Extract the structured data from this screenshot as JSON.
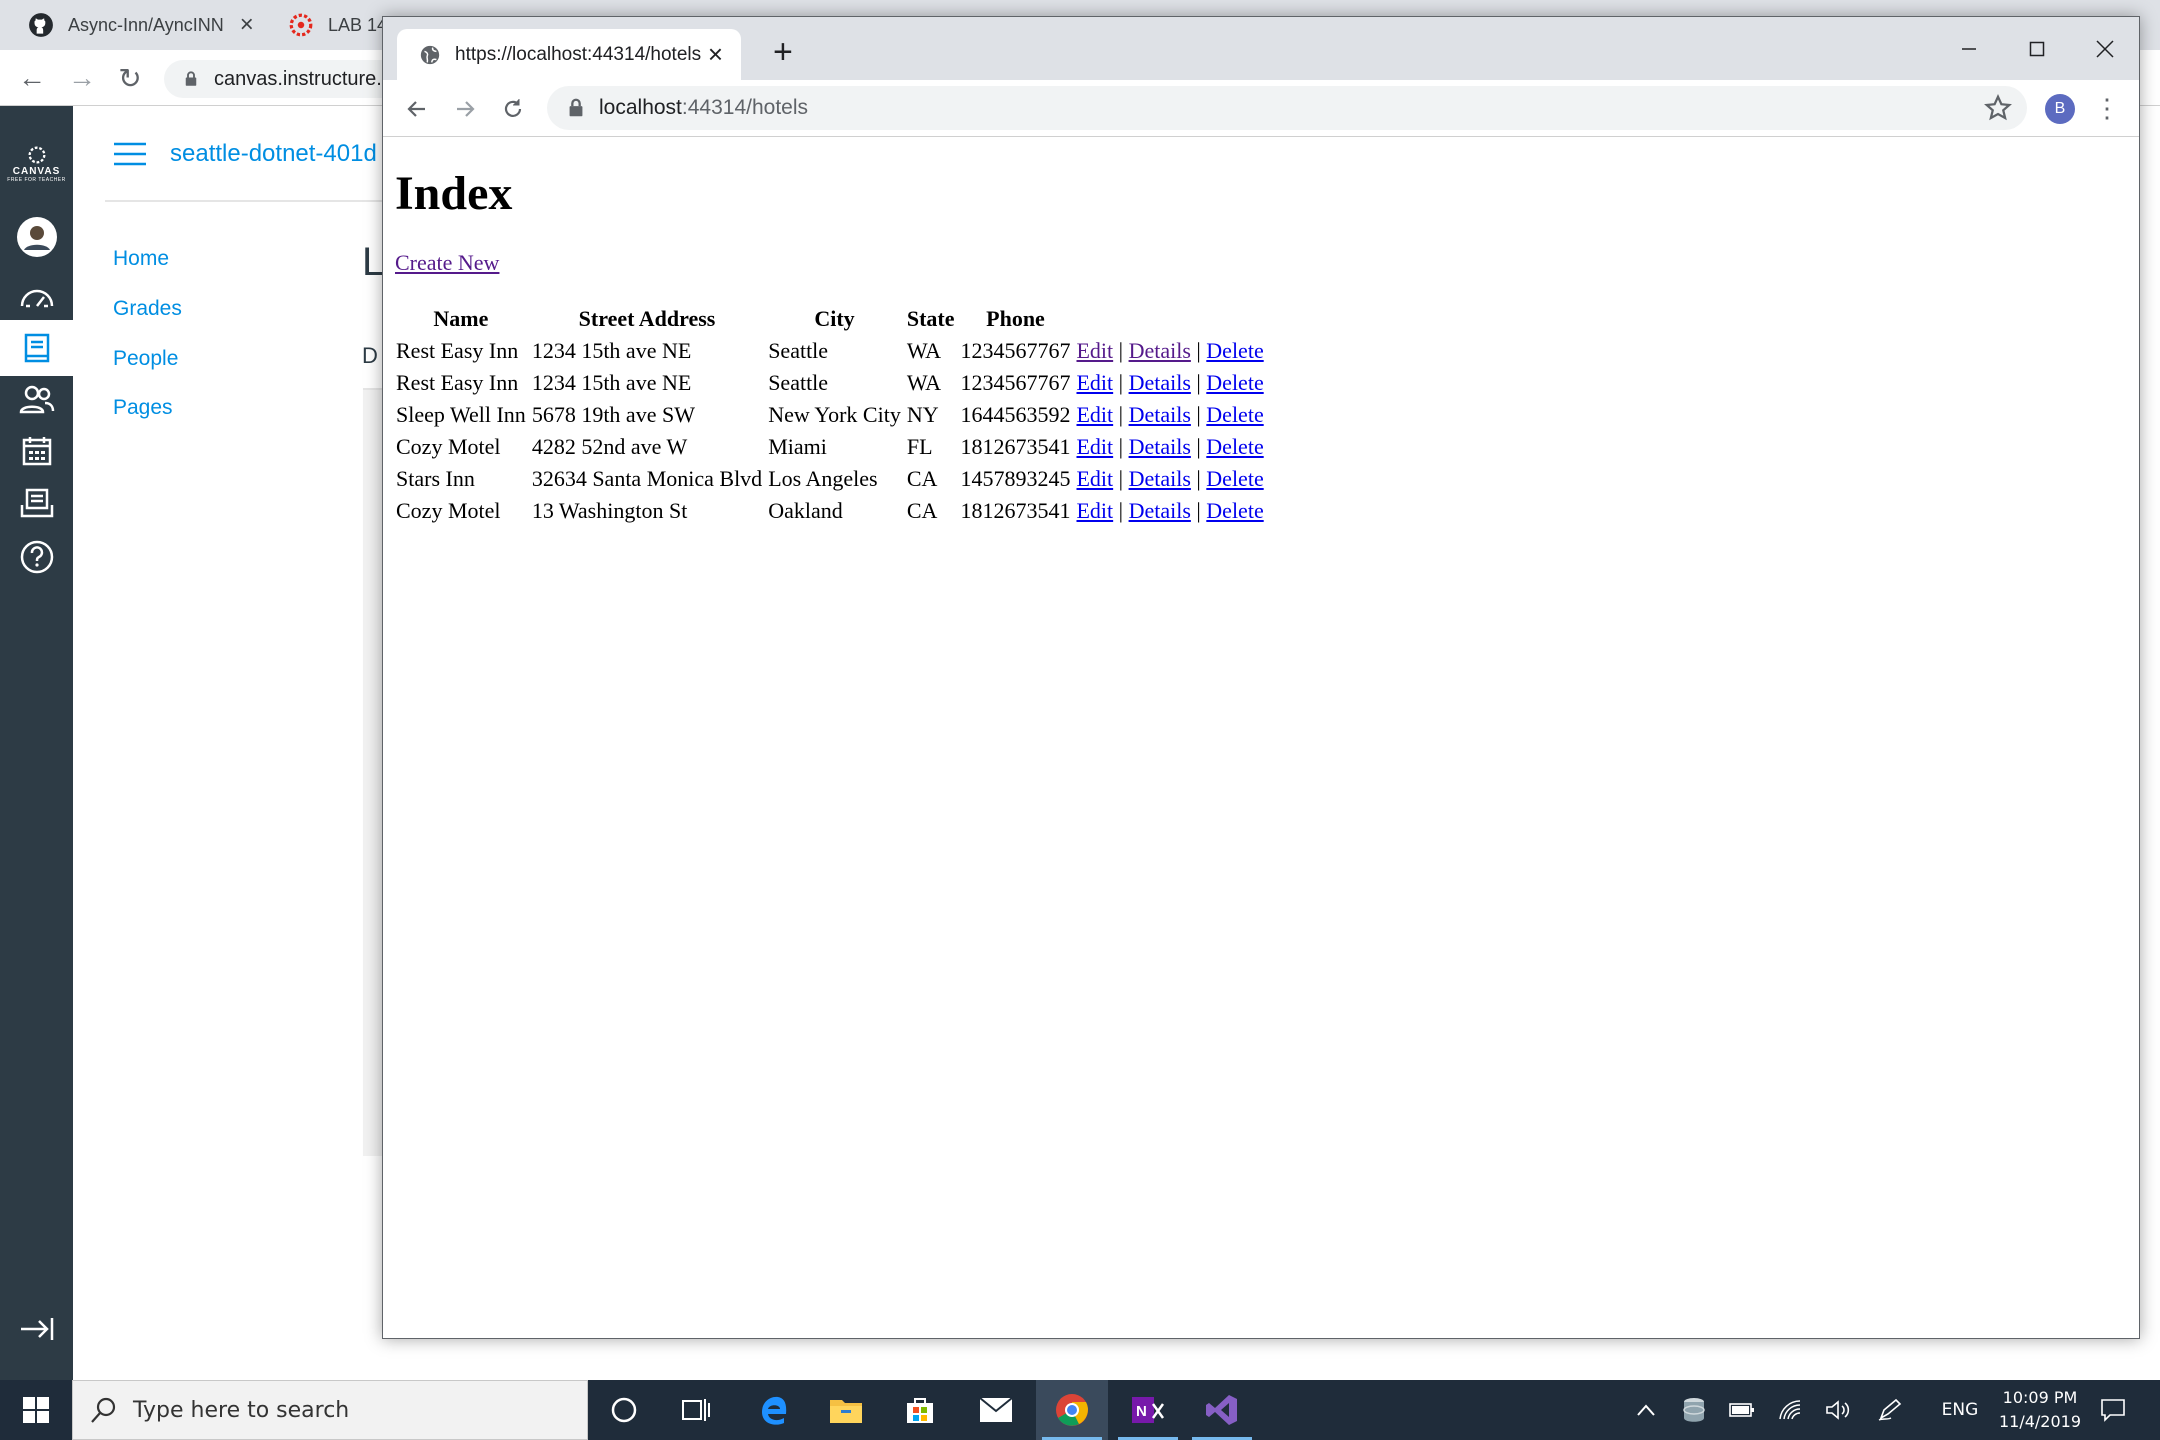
{
  "background_browser": {
    "tabs": [
      {
        "label": "Async-Inn/AyncINN"
      },
      {
        "label": "LAB 14"
      }
    ],
    "url": "canvas.instructure."
  },
  "canvas": {
    "logo_text": "CANVAS",
    "logo_subtext": "FREE FOR TEACHER",
    "course_title": "seattle-dotnet-401d",
    "nav": [
      "Home",
      "Grades",
      "People",
      "Pages"
    ],
    "content_letter_1": "L",
    "content_letter_2": "D"
  },
  "foreground_browser": {
    "tab_title": "https://localhost:44314/hotels",
    "url_host": "localhost",
    "url_rest": ":44314/hotels",
    "profile_initial": "B"
  },
  "page": {
    "title": "Index",
    "create_new_label": "Create New",
    "columns": [
      "Name",
      "Street Address",
      "City",
      "State",
      "Phone"
    ],
    "action_labels": {
      "edit": "Edit",
      "details": "Details",
      "delete": "Delete",
      "separator": "|"
    },
    "rows": [
      {
        "name": "Rest Easy Inn",
        "street": "1234 15th ave NE",
        "city": "Seattle",
        "state": "WA",
        "phone": "1234567767"
      },
      {
        "name": "Rest Easy Inn",
        "street": "1234 15th ave NE",
        "city": "Seattle",
        "state": "WA",
        "phone": "1234567767"
      },
      {
        "name": "Sleep Well Inn",
        "street": "5678 19th ave SW",
        "city": "New York City",
        "state": "NY",
        "phone": "1644563592"
      },
      {
        "name": "Cozy Motel",
        "street": "4282 52nd ave W",
        "city": "Miami",
        "state": "FL",
        "phone": "1812673541"
      },
      {
        "name": "Stars Inn",
        "street": "32634 Santa Monica Blvd",
        "city": "Los Angeles",
        "state": "CA",
        "phone": "1457893245"
      },
      {
        "name": "Cozy Motel",
        "street": "13 Washington St",
        "city": "Oakland",
        "state": "CA",
        "phone": "1812673541"
      }
    ]
  },
  "taskbar": {
    "search_placeholder": "Type here to search",
    "language": "ENG",
    "time": "10:09 PM",
    "date": "11/4/2019"
  },
  "colors": {
    "canvas_rail": "#2d3b45",
    "canvas_link": "#008ee2",
    "link_visited": "#551a8b",
    "link_unvisited": "#0000ee",
    "taskbar": "#1f2c3a"
  }
}
